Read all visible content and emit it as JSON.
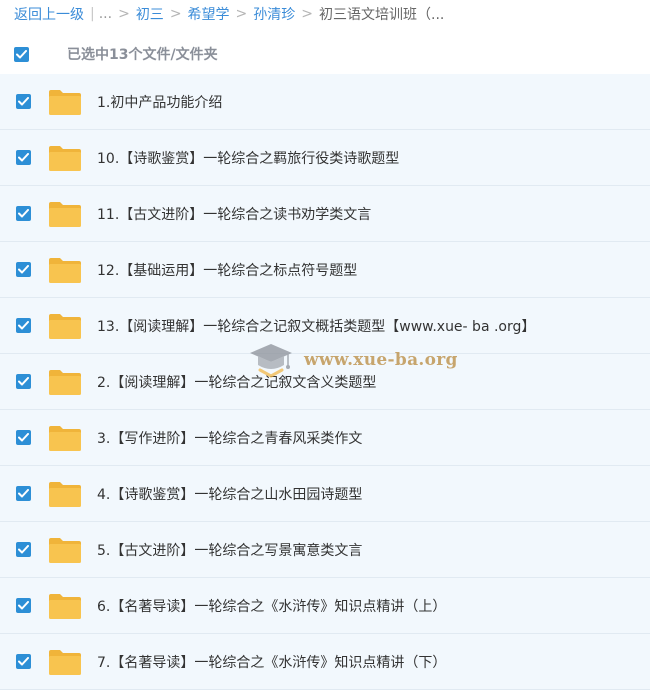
{
  "breadcrumb": {
    "back_label": "返回上一级",
    "ellipsis": "...",
    "items": [
      "初三",
      "希望学",
      "孙清珍"
    ],
    "current": "初三语文培训班（..."
  },
  "selection": {
    "label": "已选中13个文件/文件夹",
    "checked": true
  },
  "files": [
    {
      "name": "1.初中产品功能介绍",
      "type": "folder",
      "checked": true
    },
    {
      "name": "10.【诗歌鉴赏】一轮综合之羁旅行役类诗歌题型",
      "type": "folder",
      "checked": true
    },
    {
      "name": "11.【古文进阶】一轮综合之读书劝学类文言",
      "type": "folder",
      "checked": true
    },
    {
      "name": "12.【基础运用】一轮综合之标点符号题型",
      "type": "folder",
      "checked": true
    },
    {
      "name": "13.【阅读理解】一轮综合之记叙文概括类题型【www.xue- ba .org】",
      "type": "folder",
      "checked": true
    },
    {
      "name": "2.【阅读理解】一轮综合之记叙文含义类题型",
      "type": "folder",
      "checked": true
    },
    {
      "name": "3.【写作进阶】一轮综合之青春风采类作文",
      "type": "folder",
      "checked": true
    },
    {
      "name": "4.【诗歌鉴赏】一轮综合之山水田园诗题型",
      "type": "folder",
      "checked": true
    },
    {
      "name": "5.【古文进阶】一轮综合之写景寓意类文言",
      "type": "folder",
      "checked": true
    },
    {
      "name": "6.【名著导读】一轮综合之《水浒传》知识点精讲（上）",
      "type": "folder",
      "checked": true
    },
    {
      "name": "7.【名著导读】一轮综合之《水浒传》知识点精讲（下）",
      "type": "folder",
      "checked": true
    }
  ],
  "watermark": {
    "text": "www.xue-ba.org"
  },
  "colors": {
    "accent": "#2d8fd6",
    "link": "#3b8cd8",
    "row_bg": "#f2f8fd",
    "folder": "#f8c44f"
  }
}
